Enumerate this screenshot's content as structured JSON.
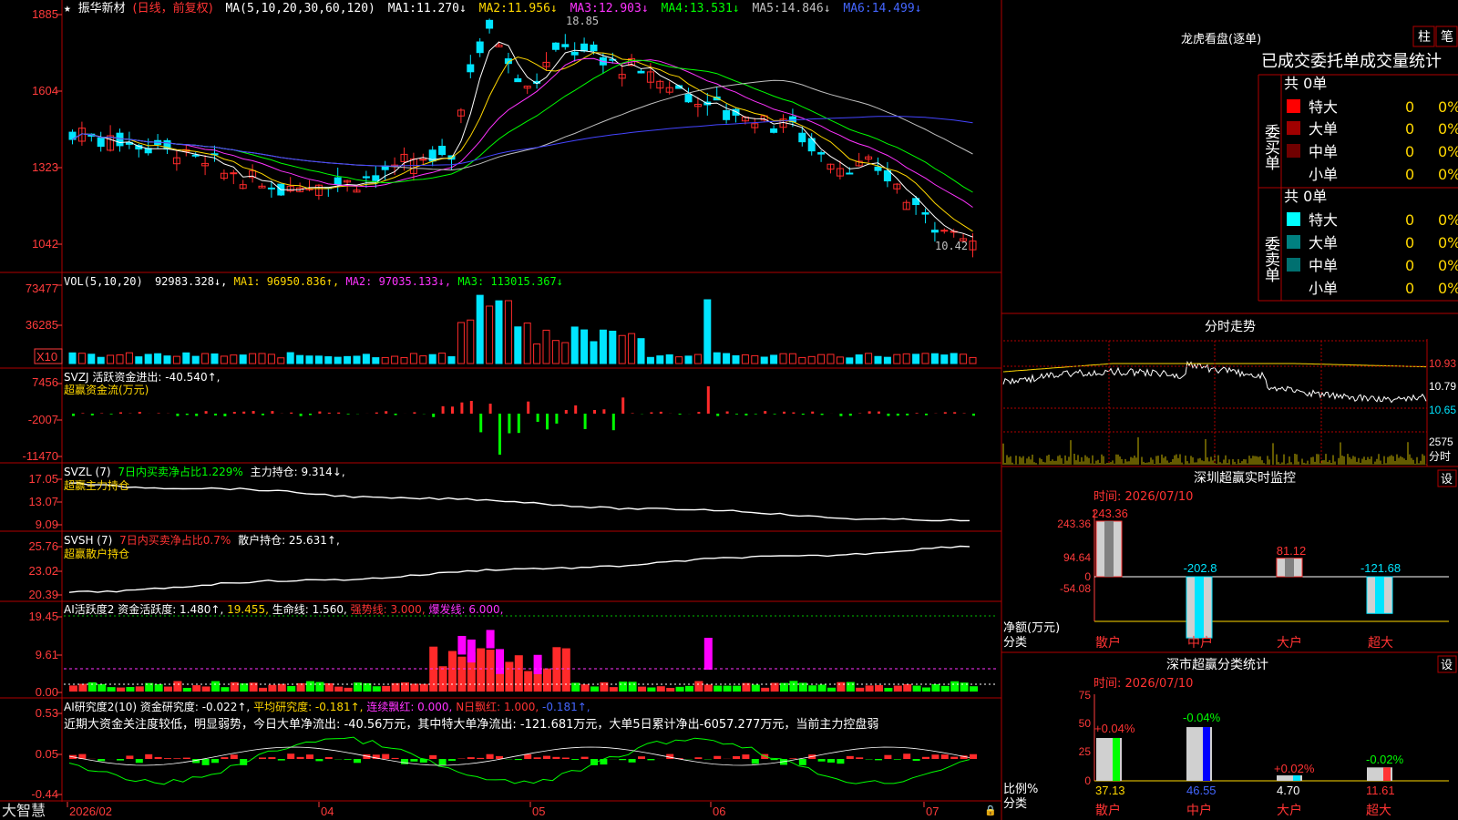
{
  "colors": {
    "up": "#ff2a2a",
    "down": "#00e5ff",
    "grid": "#b00000",
    "ma1": "#ffffff",
    "ma2": "#ffd700",
    "ma3": "#ff33ff",
    "ma4": "#00ff00",
    "ma5": "#c0c0c0",
    "ma6": "#4444ff"
  },
  "main": {
    "star": "★",
    "stock": "振华新材",
    "period": "(日线，前复权)",
    "ma_label": "MA(5,10,20,30,60,120)",
    "ma": [
      {
        "k": "MA1:",
        "v": "11.270↓"
      },
      {
        "k": "MA2:",
        "v": "11.956↓"
      },
      {
        "k": "MA3:",
        "v": "12.903↓"
      },
      {
        "k": "MA4:",
        "v": "13.531↓"
      },
      {
        "k": "MA5:",
        "v": "14.846↓"
      },
      {
        "k": "MA6:",
        "v": "14.499↓"
      }
    ],
    "axis": [
      "1885",
      "1604",
      "1323",
      "1042"
    ],
    "hi": "18.85",
    "lo": "10.42"
  },
  "vol": {
    "label": "VOL(5,10,20)",
    "v0": "92983.328↓,",
    "ma1": "MA1: 96950.836↑,",
    "ma2": "MA2: 97035.133↓,",
    "ma3": "MA3: 113015.367↓",
    "axis": [
      "73477",
      "36285"
    ],
    "unit": "X10"
  },
  "svzj": {
    "l1": "SVZJ  活跃资金进出: -40.540↑,",
    "l2": "超赢资金流(万元)",
    "axis": [
      "7456",
      "-2007",
      "-11470"
    ]
  },
  "svzl": {
    "a": "SVZL (7)",
    "b": "7日内买卖净占比1.229%",
    "c": "主力持仓: 9.314↓,",
    "l2": "超赢主力持仓",
    "axis": [
      "17.05",
      "13.07",
      "9.09"
    ]
  },
  "svsh": {
    "a": "SVSH (7)",
    "b": "7日内买卖净占比0.7%",
    "c": "散户持仓: 25.631↑,",
    "l2": "超赢散户持仓",
    "axis": [
      "25.76",
      "23.02",
      "20.39"
    ]
  },
  "ai1": {
    "a": "AI活跃度2 资金活跃度: 1.480↑,",
    "b": "19.455,",
    "c": "生命线: 1.560,",
    "d": "强势线: 3.000,",
    "e": "爆发线: 6.000,",
    "axis": [
      "19.45",
      "9.61",
      "0.00"
    ]
  },
  "ai2": {
    "a": "AI研究度2(10) 资金研究度: -0.022↑,",
    "b": "平均研究度: -0.181↑,",
    "c": "连续飘红: 0.000,",
    "d": "N日飘红: 1.000,",
    "e": "-0.181↑,",
    "text": "近期大资金关注度较低，明显弱势，今日大单净流出: -40.56万元，其中特大单净流出: -121.681万元，大单5日累计净出-6057.277万元，当前主力控盘弱",
    "axis": [
      "0.53",
      "0.05",
      "-0.44"
    ]
  },
  "dates": [
    "2026/02",
    "04",
    "05",
    "06",
    "07"
  ],
  "brand": "大智慧",
  "lhb": {
    "title": "龙虎看盘(逐单)",
    "btn1": "柱",
    "btn2": "笔",
    "sub": "已成交委托单成交量统计",
    "buy_total": "共 0单",
    "buy_side": "委买单",
    "sell_total": "共 0单",
    "sell_side": "委卖单",
    "rows": [
      {
        "n": "特大",
        "v": "0",
        "p": "0%"
      },
      {
        "n": "大单",
        "v": "0",
        "p": "0%"
      },
      {
        "n": "中单",
        "v": "0",
        "p": "0%"
      },
      {
        "n": "小单",
        "v": "0",
        "p": "0%"
      }
    ]
  },
  "intraday": {
    "title": "分时走势",
    "axis": [
      "10.93",
      "10.79",
      "10.65"
    ],
    "vol": [
      "2575",
      "分时"
    ]
  },
  "monitor": {
    "title": "深圳超赢实时监控",
    "btn": "设",
    "time": "时间: 2026/07/10",
    "axis": [
      "243.36",
      "94.64",
      "0",
      "-54.08",
      "-202.8"
    ],
    "ylabel": "净额(万元)",
    "xlabel": "分类",
    "bars": [
      {
        "n": "散户",
        "v": "243.36"
      },
      {
        "n": "中户",
        "v": "-202.8"
      },
      {
        "n": "大户",
        "v": "81.12"
      },
      {
        "n": "超大",
        "v": "-121.68"
      }
    ]
  },
  "stats": {
    "title": "深市超赢分类统计",
    "btn": "设",
    "time": "时间: 2026/07/10",
    "axis": [
      "75",
      "50",
      "25",
      "0"
    ],
    "ylabel": "比例%",
    "xlabel": "分类",
    "bars": [
      {
        "n": "散户",
        "v": "37.13",
        "d": "+0.04%"
      },
      {
        "n": "中户",
        "v": "46.55",
        "d": "-0.04%"
      },
      {
        "n": "大户",
        "v": "4.70",
        "d": "+0.02%"
      },
      {
        "n": "超大",
        "v": "11.61",
        "d": "-0.02%"
      }
    ]
  }
}
